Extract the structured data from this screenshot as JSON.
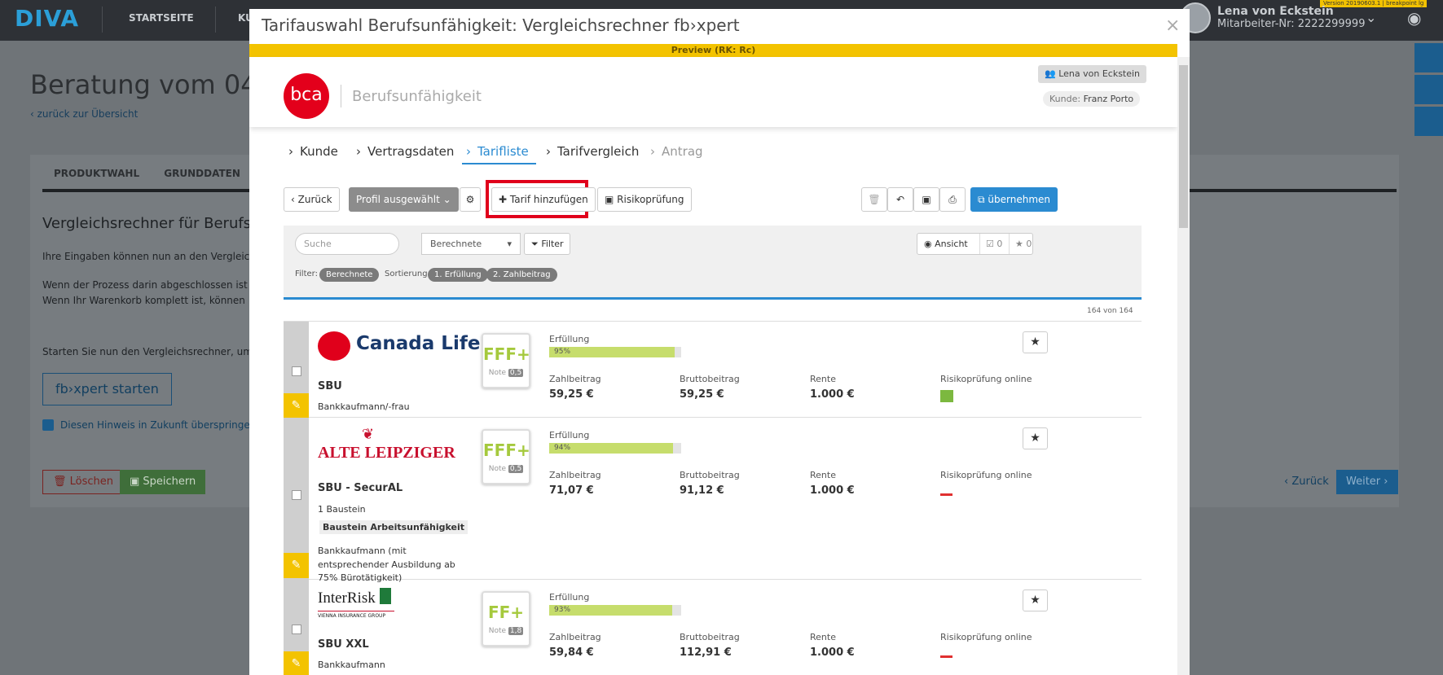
{
  "topbar": {
    "logo": "DIVA",
    "nav": [
      "STARTSEITE",
      "KU"
    ],
    "user_name": "Lena von Eckstein",
    "employee_no": "Mitarbeiter-Nr: 2222299999",
    "version": "Version 20190603.1 | breakpoint lg"
  },
  "background": {
    "title": "Beratung vom 04.",
    "back_link": "zurück zur Übersicht",
    "tabs": [
      "PRODUKTWAHL",
      "GRUNDDATEN"
    ],
    "heading": "Vergleichsrechner für Berufsu",
    "p1": "Ihre Eingaben können nun an den Vergleic",
    "p2a": "Wenn der Prozess darin abgeschlossen ist",
    "p2b": "Wenn Ihr Warenkorb komplett ist, können",
    "p3": "Starten Sie nun den Vergleichsrechner, um",
    "start_button": "fb›xpert starten",
    "checkbox_label": "Diesen Hinweis in Zukunft überspringen",
    "delete_button": "Löschen",
    "save_button": "Speichern",
    "back_button": "Zurück",
    "next_button": "Weiter"
  },
  "modal": {
    "title": "Tarifauswahl Berufsunfähigkeit: Vergleichsrechner fb›xpert",
    "preview": "Preview (RK: Rc)",
    "brand": "bca",
    "product": "Berufsunfähigkeit",
    "user_badge": "Lena von Eckstein",
    "kunde_label": "Kunde:",
    "kunde_name": "Franz Porto",
    "steps": [
      "Kunde",
      "Vertragsdaten",
      "Tarifliste",
      "Tarifvergleich",
      "Antrag"
    ],
    "toolbar": {
      "back": "Zurück",
      "profile": "Profil ausgewählt",
      "add_tariff": "Tarif hinzufügen",
      "risk_check": "Risikoprüfung",
      "accept": "übernehmen"
    },
    "filter": {
      "search_placeholder": "Suche",
      "sort_value": "Berechnete",
      "filter_button": "Filter",
      "view_button": "Ansicht",
      "compare_count": "0",
      "fav_count": "0",
      "filter_label": "Filter:",
      "filter_pill": "Berechnete",
      "sort_label": "Sortierung:",
      "sort_pill_1": "1. Erfüllung",
      "sort_pill_2": "2. Zahlbeitrag",
      "count": "164 von 164"
    },
    "col_labels": {
      "fulfillment": "Erfüllung",
      "payment": "Zahlbeitrag",
      "gross": "Bruttobeitrag",
      "pension": "Rente",
      "risk_online": "Risikoprüfung online",
      "note": "Note"
    },
    "results": [
      {
        "insurer": "Canada Life",
        "product": "SBU",
        "desc": "Bankkaufmann/-frau",
        "rating": "FFF+",
        "grade": "0,5",
        "fulfillment": "95%",
        "fulfillment_value": 0.95,
        "payment": "59,25 €",
        "gross": "59,25 €",
        "pension": "1.000 €",
        "risk_online": true
      },
      {
        "insurer": "ALTE LEIPZIGER",
        "product": "SBU - SecurAL",
        "modules": "1 Baustein",
        "module_tag": "Baustein Arbeitsunfähigkeit",
        "desc1": "Bankkaufmann (mit",
        "desc2": "entsprechender Ausbildung ab",
        "desc3": "75% Bürotätigkeit)",
        "rating": "FFF+",
        "grade": "0,5",
        "fulfillment": "94%",
        "fulfillment_value": 0.94,
        "payment": "71,07 €",
        "gross": "91,12 €",
        "pension": "1.000 €",
        "risk_online": false
      },
      {
        "insurer": "InterRisk",
        "insurer_sub": "VIENNA INSURANCE GROUP",
        "product": "SBU XXL",
        "desc": "Bankkaufmann",
        "rating": "FF+",
        "grade": "1,8",
        "fulfillment": "93%",
        "fulfillment_value": 0.93,
        "payment": "59,84 €",
        "gross": "112,91 €",
        "pension": "1.000 €",
        "risk_online": false
      }
    ]
  },
  "colors": {
    "accent": "#2b8bd1",
    "preview": "#f3c300",
    "brand_red": "#e3001b",
    "highlight": "#e0001b"
  }
}
